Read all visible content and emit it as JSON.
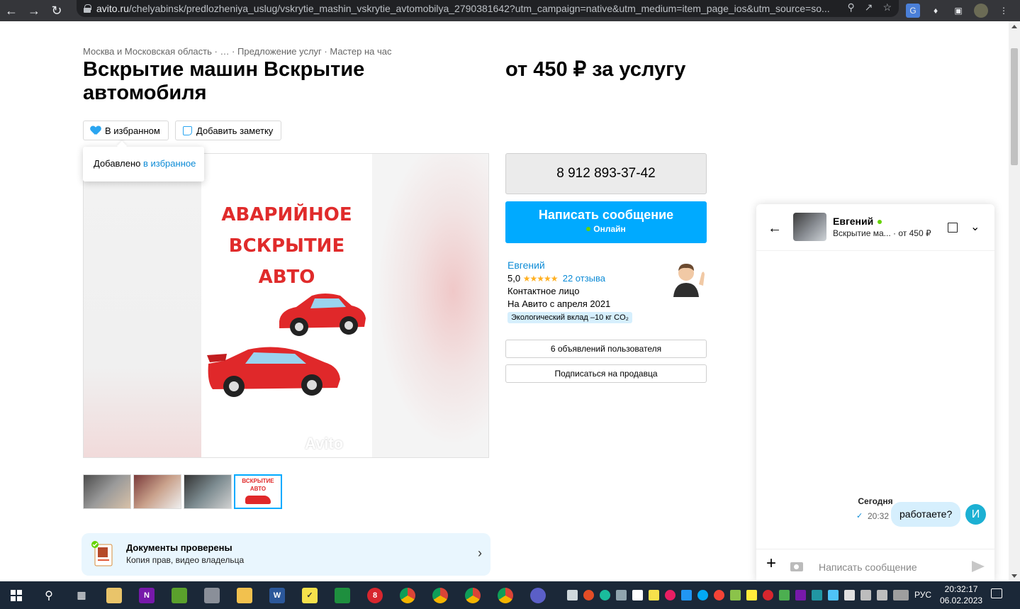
{
  "browser": {
    "url_domain": "avito.ru",
    "url_path": "/chelyabinsk/predlozheniya_uslug/vskrytie_mashin_vskrytie_avtomobilya_2790381642?utm_campaign=native&utm_medium=item_page_ios&utm_source=so..."
  },
  "page": {
    "breadcrumb": "Москва и Московская область · … · Предложение услуг · Мастер на час",
    "title": "Вскрытие машин Вскрытие автомобиля",
    "price": "от 450 ₽ за услугу",
    "favorite_label": "В избранном",
    "note_label": "Добавить заметку",
    "tooltip_text": "Добавлено ",
    "tooltip_link": "в избранное",
    "ad_image_text_1": "АВАРИЙНОЕ",
    "ad_image_text_2": "ВСКРЫТИЕ",
    "ad_image_text_3": "АВТО",
    "watermark": "Avito",
    "thumb_text": "ВСКРЫТИЕ АВТО",
    "docs_title": "Документы проверены",
    "docs_sub": "Копия прав, видео владельца"
  },
  "contact": {
    "phone": "8 912 893-37-42",
    "message_label": "Написать сообщение",
    "online_label": "Онлайн"
  },
  "seller": {
    "name": "Евгений",
    "rating": "5,0",
    "stars": "★★★★★",
    "reviews": "22 отзыва",
    "role": "Контактное лицо",
    "since": "На Авито с апреля 2021",
    "eco": "Экологический вклад –10 кг CO₂",
    "listings": "6 объявлений пользователя",
    "subscribe": "Подписаться на продавца"
  },
  "chat": {
    "name": "Евгений",
    "subtitle": "Вскрытие ма...  · от 450 ₽",
    "day": "Сегодня",
    "time": "20:32",
    "message": "работаете?",
    "me_initial": "И",
    "input_placeholder": "Написать сообщение"
  },
  "taskbar": {
    "lang": "РУС",
    "time": "20:32:17",
    "date": "06.02.2023"
  },
  "colors": {
    "accent": "#00aaff",
    "link": "#0c8bd6",
    "online": "#65d300",
    "ad_red": "#e02b2b"
  }
}
